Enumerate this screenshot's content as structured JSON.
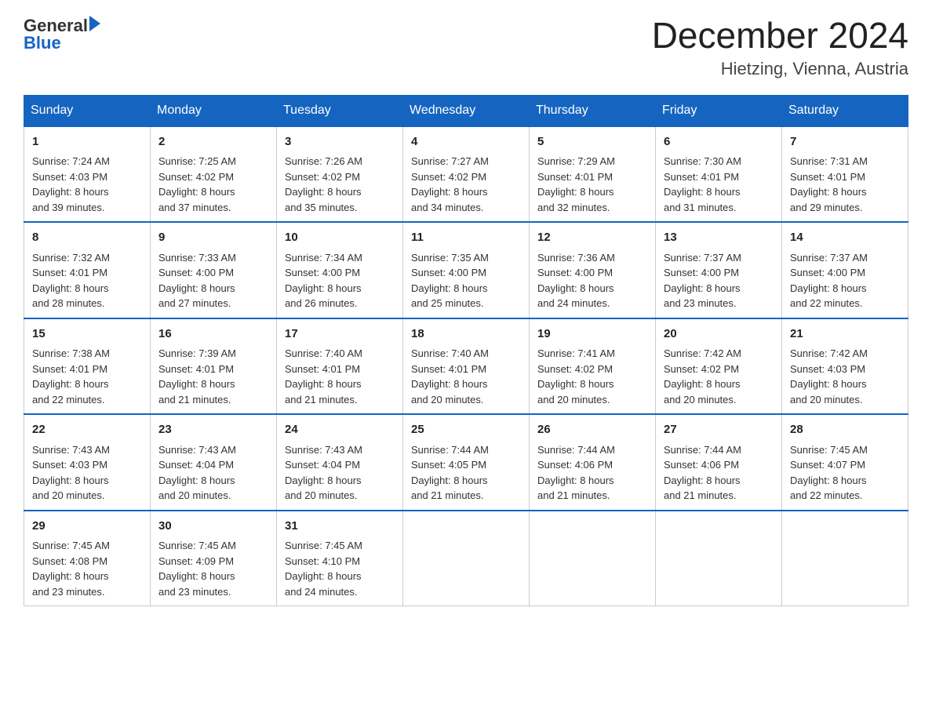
{
  "logo": {
    "general": "General",
    "blue": "Blue"
  },
  "header": {
    "month": "December 2024",
    "location": "Hietzing, Vienna, Austria"
  },
  "weekdays": [
    "Sunday",
    "Monday",
    "Tuesday",
    "Wednesday",
    "Thursday",
    "Friday",
    "Saturday"
  ],
  "weeks": [
    [
      {
        "day": "1",
        "sunrise": "7:24 AM",
        "sunset": "4:03 PM",
        "daylight": "8 hours and 39 minutes."
      },
      {
        "day": "2",
        "sunrise": "7:25 AM",
        "sunset": "4:02 PM",
        "daylight": "8 hours and 37 minutes."
      },
      {
        "day": "3",
        "sunrise": "7:26 AM",
        "sunset": "4:02 PM",
        "daylight": "8 hours and 35 minutes."
      },
      {
        "day": "4",
        "sunrise": "7:27 AM",
        "sunset": "4:02 PM",
        "daylight": "8 hours and 34 minutes."
      },
      {
        "day": "5",
        "sunrise": "7:29 AM",
        "sunset": "4:01 PM",
        "daylight": "8 hours and 32 minutes."
      },
      {
        "day": "6",
        "sunrise": "7:30 AM",
        "sunset": "4:01 PM",
        "daylight": "8 hours and 31 minutes."
      },
      {
        "day": "7",
        "sunrise": "7:31 AM",
        "sunset": "4:01 PM",
        "daylight": "8 hours and 29 minutes."
      }
    ],
    [
      {
        "day": "8",
        "sunrise": "7:32 AM",
        "sunset": "4:01 PM",
        "daylight": "8 hours and 28 minutes."
      },
      {
        "day": "9",
        "sunrise": "7:33 AM",
        "sunset": "4:00 PM",
        "daylight": "8 hours and 27 minutes."
      },
      {
        "day": "10",
        "sunrise": "7:34 AM",
        "sunset": "4:00 PM",
        "daylight": "8 hours and 26 minutes."
      },
      {
        "day": "11",
        "sunrise": "7:35 AM",
        "sunset": "4:00 PM",
        "daylight": "8 hours and 25 minutes."
      },
      {
        "day": "12",
        "sunrise": "7:36 AM",
        "sunset": "4:00 PM",
        "daylight": "8 hours and 24 minutes."
      },
      {
        "day": "13",
        "sunrise": "7:37 AM",
        "sunset": "4:00 PM",
        "daylight": "8 hours and 23 minutes."
      },
      {
        "day": "14",
        "sunrise": "7:37 AM",
        "sunset": "4:00 PM",
        "daylight": "8 hours and 22 minutes."
      }
    ],
    [
      {
        "day": "15",
        "sunrise": "7:38 AM",
        "sunset": "4:01 PM",
        "daylight": "8 hours and 22 minutes."
      },
      {
        "day": "16",
        "sunrise": "7:39 AM",
        "sunset": "4:01 PM",
        "daylight": "8 hours and 21 minutes."
      },
      {
        "day": "17",
        "sunrise": "7:40 AM",
        "sunset": "4:01 PM",
        "daylight": "8 hours and 21 minutes."
      },
      {
        "day": "18",
        "sunrise": "7:40 AM",
        "sunset": "4:01 PM",
        "daylight": "8 hours and 20 minutes."
      },
      {
        "day": "19",
        "sunrise": "7:41 AM",
        "sunset": "4:02 PM",
        "daylight": "8 hours and 20 minutes."
      },
      {
        "day": "20",
        "sunrise": "7:42 AM",
        "sunset": "4:02 PM",
        "daylight": "8 hours and 20 minutes."
      },
      {
        "day": "21",
        "sunrise": "7:42 AM",
        "sunset": "4:03 PM",
        "daylight": "8 hours and 20 minutes."
      }
    ],
    [
      {
        "day": "22",
        "sunrise": "7:43 AM",
        "sunset": "4:03 PM",
        "daylight": "8 hours and 20 minutes."
      },
      {
        "day": "23",
        "sunrise": "7:43 AM",
        "sunset": "4:04 PM",
        "daylight": "8 hours and 20 minutes."
      },
      {
        "day": "24",
        "sunrise": "7:43 AM",
        "sunset": "4:04 PM",
        "daylight": "8 hours and 20 minutes."
      },
      {
        "day": "25",
        "sunrise": "7:44 AM",
        "sunset": "4:05 PM",
        "daylight": "8 hours and 21 minutes."
      },
      {
        "day": "26",
        "sunrise": "7:44 AM",
        "sunset": "4:06 PM",
        "daylight": "8 hours and 21 minutes."
      },
      {
        "day": "27",
        "sunrise": "7:44 AM",
        "sunset": "4:06 PM",
        "daylight": "8 hours and 21 minutes."
      },
      {
        "day": "28",
        "sunrise": "7:45 AM",
        "sunset": "4:07 PM",
        "daylight": "8 hours and 22 minutes."
      }
    ],
    [
      {
        "day": "29",
        "sunrise": "7:45 AM",
        "sunset": "4:08 PM",
        "daylight": "8 hours and 23 minutes."
      },
      {
        "day": "30",
        "sunrise": "7:45 AM",
        "sunset": "4:09 PM",
        "daylight": "8 hours and 23 minutes."
      },
      {
        "day": "31",
        "sunrise": "7:45 AM",
        "sunset": "4:10 PM",
        "daylight": "8 hours and 24 minutes."
      },
      null,
      null,
      null,
      null
    ]
  ],
  "labels": {
    "sunrise": "Sunrise:",
    "sunset": "Sunset:",
    "daylight": "Daylight:"
  }
}
